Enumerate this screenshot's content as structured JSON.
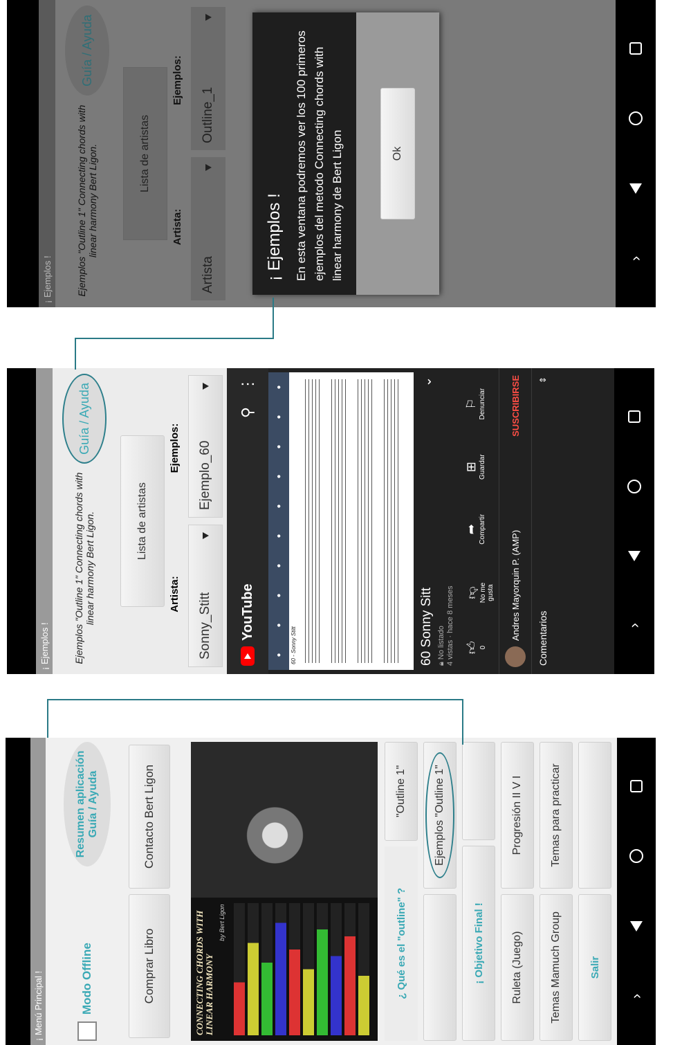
{
  "menu": {
    "title": "¡ Menú Principal !",
    "offline_label": "Modo Offline",
    "resumen_label": "Resumen aplicación",
    "guia_label": "Guía / Ayuda",
    "comprar_label": "Comprar Libro",
    "contacto_label": "Contacto Bert Ligon",
    "book_title": "CONNECTING CHORDS WITH LINEAR HARMONY",
    "book_author": "by Bert Ligon",
    "que_es_label": "¿ Qué es el \"outline\" ?",
    "outline1_label": "\"Outline 1\"",
    "ejemplos_label": "Ejemplos \"Outline 1\"",
    "objetivo_label": "¡ Objetivo Final !",
    "ruleta_label": "Ruleta (Juego)",
    "progresion_label": "Progresión II V I",
    "mamuch_label": "Temas Mamuch Group",
    "practicar_label": "Temas para practicar",
    "salir_label": "Salir"
  },
  "ejemplos": {
    "title": "¡ Ejemplos !",
    "subtitle": "Ejemplos \"Outline 1\" Connecting chords with linear harmony Bert Ligon.",
    "guia_label": "Guía / Ayuda",
    "lista_label": "Lista de artistas",
    "artista_label": "Artista:",
    "ejemplos_label": "Ejemplos:",
    "artist_value": "Sonny_Stitt",
    "example_value": "Ejemplo_60",
    "sheet_title": "60 - Sonny Stitt"
  },
  "youtube": {
    "logo": "YouTube",
    "video_title": "60 Sonny Sitt",
    "unlisted": "No listado",
    "meta": "4 vistas · hace 8 meses",
    "like_count": "0",
    "dislike_label": "No me gusta",
    "share_label": "Compartir",
    "save_label": "Guardar",
    "report_label": "Denunciar",
    "channel": "Andres Mayorquin P. (AMP)",
    "subscribe": "SUSCRIBIRSE",
    "comments": "Comentarios"
  },
  "dialog_screen": {
    "title": "¡ Ejemplos !",
    "subtitle": "Ejemplos \"Outline 1\" Connecting chords with linear harmony Bert Ligon.",
    "guia_label": "Guía / Ayuda",
    "lista_label": "Lista de artistas",
    "artista_label": "Artista:",
    "ejemplos_label": "Ejemplos:",
    "artist_value": "Artista",
    "example_value": "Outline_1",
    "dialog_title": "¡ Ejemplos !",
    "dialog_text": "En esta ventana podremos ver los 100 primeros ejemplos del metodo Connecting chords with linear harmony de Bert Ligon",
    "ok_label": "Ok"
  },
  "colors": {
    "accent": "#3aa9b5",
    "connector": "#2a7a86",
    "youtube_red": "#ff0000",
    "subscribe_red": "#ff4e45"
  }
}
